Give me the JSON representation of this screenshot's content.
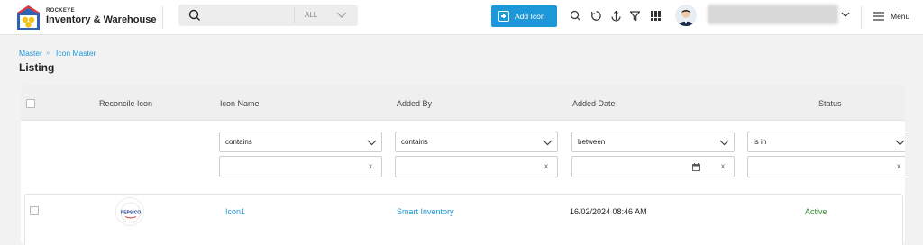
{
  "header": {
    "brand_small": "ROCKEYE",
    "brand_title": "Inventory & Warehouse",
    "search": {
      "placeholder": "",
      "value": "",
      "scope": "ALL"
    },
    "add_button_label": "Add Icon",
    "icons": [
      "search-icon",
      "refresh-icon",
      "anchor-icon",
      "filter-icon",
      "apps-grid-icon"
    ],
    "user_chevron": "chevron-down-icon",
    "menu_label": "Menu"
  },
  "breadcrumb": {
    "items": [
      "Master",
      "Icon Master"
    ],
    "separator": "»"
  },
  "page_title": "Listing",
  "table": {
    "columns": [
      "Reconcile Icon",
      "Icon Name",
      "Added By",
      "Added Date",
      "Status"
    ],
    "filters": {
      "icon_name": {
        "operator": "contains",
        "value": ""
      },
      "added_by": {
        "operator": "contains",
        "value": ""
      },
      "added_date": {
        "operator": "between",
        "value": ""
      },
      "status": {
        "operator": "is in",
        "value": ""
      }
    },
    "clear_glyph": "x",
    "rows": [
      {
        "reconcile_icon": {
          "image": "pepsico-logo",
          "text": "PEPSICO"
        },
        "icon_name": "Icon1",
        "added_by": "Smart Inventory",
        "added_date": "16/02/2024 08:46 AM",
        "status": "Active"
      }
    ]
  },
  "colors": {
    "accent": "#1c97d8",
    "status_active": "#2e8b2e",
    "header_bg": "#efefef"
  }
}
